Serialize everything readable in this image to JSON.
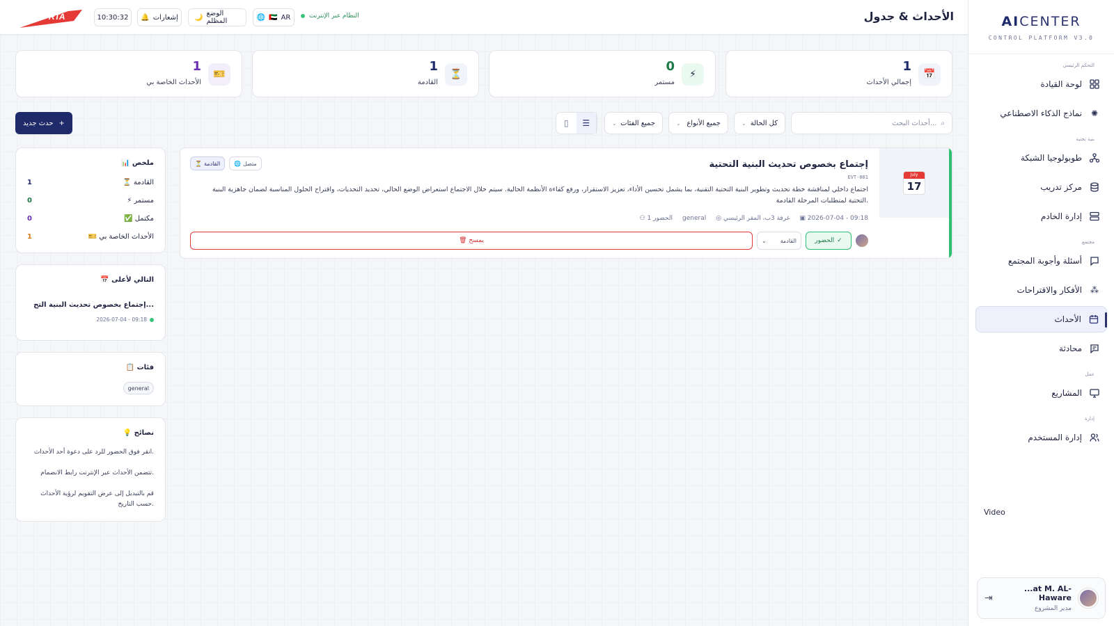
{
  "header": {
    "page_title": "الأحداث & جدول",
    "logo_text": "RTA",
    "clock": "10:30:32",
    "notifications_label": "إشعارات",
    "dark_mode_label": "الوضع المظلم",
    "language_label": "AR",
    "system_status": "النظام عبر الإنترنت"
  },
  "sidebar": {
    "brand_ai": "AI",
    "brand_center": "CENTER",
    "brand_sub": "CONTROL PLATFORM V3.0",
    "sections": {
      "main": "التحكم الرئيسي",
      "network": "بنية تحتية",
      "community": "مجتمع",
      "work": "عمل",
      "admin": "إدارة"
    },
    "items": [
      {
        "label": "لوحة القيادة",
        "icon": "dashboard-icon"
      },
      {
        "label": "نماذج الذكاء الاصطناعي",
        "icon": "ai-models-icon"
      },
      {
        "label": "طوبولوجيا الشبكة",
        "icon": "network-icon"
      },
      {
        "label": "مركز تدريب",
        "icon": "database-icon"
      },
      {
        "label": "إدارة الخادم",
        "icon": "server-icon"
      },
      {
        "label": "أسئلة وأجوبة المجتمع",
        "icon": "message-icon"
      },
      {
        "label": "الأفكار والاقتراحات",
        "icon": "loader-icon"
      },
      {
        "label": "الأحداث",
        "icon": "calendar-icon"
      },
      {
        "label": "محادثة",
        "icon": "chat-icon"
      },
      {
        "label": "المشاريع",
        "icon": "monitor-icon"
      },
      {
        "label": "إدارة المستخدم",
        "icon": "users-icon"
      }
    ],
    "video_label": "Video",
    "user": {
      "name": "...at M. AL-Haware",
      "role": "مدير المشروع"
    }
  },
  "stats": [
    {
      "value": "1",
      "label": "إجمالي الأحداث",
      "icon": "📅",
      "color": "#1f2a6b"
    },
    {
      "value": "0",
      "label": "مستمر",
      "icon": "⚡",
      "color": "#1d7a47"
    },
    {
      "value": "1",
      "label": "القادمة",
      "icon": "⏳",
      "color": "#1f2a6b"
    },
    {
      "value": "1",
      "label": "الأحداث الخاصة بي",
      "icon": "🎫",
      "color": "#6a2fb0"
    }
  ],
  "filters": {
    "search_placeholder": "أحداث البحث...",
    "status": "كل الحالة",
    "types": "جميع الأنواع",
    "categories": "جميع الفئات",
    "new_event": "حدث جديد"
  },
  "event": {
    "month": "July",
    "day": "17",
    "title": "إجتماع بخصوص تحديث البنية التحتية",
    "code": "EVT-001",
    "description": "اجتماع داخلي لمناقشة خطة تحديث وتطوير البنية التحتية التقنية، بما يشمل تحسين الأداء، تعزيز الاستقرار، ورفع كفاءة الأنظمة الحالية. سيتم خلال الاجتماع استعراض الوضع الحالي، تحديد التحديات، واقتراح الحلول المناسبة لضمان جاهزية البنية التحتية لمتطلبات المرحلة القادمة.",
    "datetime": "2026-07-04 - 09:18",
    "location": "غرفة 3ب، المقر الرئيسي",
    "category": "general",
    "attendees": "1 الحضور",
    "mode_tag": "متصل",
    "status_tag": "القادمة",
    "attend_label": "الحضور",
    "status_select": "القادمة",
    "delete_label": "🗑 يمسح"
  },
  "summary": {
    "title": "📊 ملخص",
    "rows": [
      {
        "label": "⏳ القادمة",
        "value": "1",
        "color": "#1f2a6b"
      },
      {
        "label": "⚡ مستمر",
        "value": "0",
        "color": "#1d7a47"
      },
      {
        "label": "✅ مكتمل",
        "value": "0",
        "color": "#6a2fb0"
      },
      {
        "label": "🎫 الأحداث الخاصة بي",
        "value": "1",
        "color": "#d97a1a"
      }
    ]
  },
  "next_up": {
    "title": "📅 التالي لأعلى",
    "event_title": "إجتماع بخصوص تحديث البنية التح...",
    "time": "2026-07-04 - 09:18"
  },
  "categories_panel": {
    "title": "📋 فئات",
    "chip": "general"
  },
  "tips": {
    "title": "💡 نصائح",
    "items": [
      "انقر فوق الحضور للرد على دعوة أحد الأحداث.",
      "تتضمن الأحداث عبر الإنترنت رابط الانضمام.",
      "قم بالتبديل إلى عرض التقويم لرؤية الأحداث حسب التاريخ."
    ]
  }
}
